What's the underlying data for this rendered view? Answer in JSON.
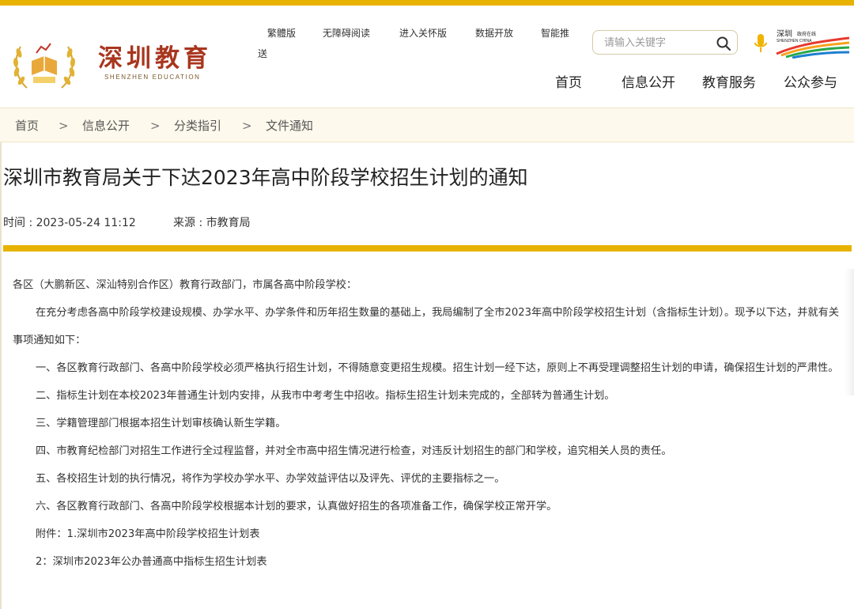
{
  "header": {
    "logo_cn": "深圳教育",
    "logo_en": "SHENZHEN EDUCATION",
    "utility_links": [
      "繁體版",
      "无障碍阅读",
      "进入关怀版",
      "数据开放",
      "智能推",
      "送"
    ],
    "search_placeholder": "请输入关键字",
    "nav": [
      "首页",
      "信息公开",
      "教育服务",
      "公众参与"
    ]
  },
  "breadcrumb": {
    "items": [
      "首页",
      "信息公开",
      "分类指引",
      "文件通知"
    ],
    "separator": ">"
  },
  "article": {
    "title": "深圳市教育局关于下达2023年高中阶段学校招生计划的通知",
    "time": "时间 : 2023-05-24 11:12",
    "source": "来源 : 市教育局",
    "paragraphs": [
      "各区（大鹏新区、深汕特别合作区）教育行政部门，市属各高中阶段学校：",
      "在充分考虑各高中阶段学校建设规模、办学水平、办学条件和历年招生数量的基础上，我局编制了全市2023年高中阶段学校招生计划（含指标生计划）。现予以下达，并就有关事项通知如下：",
      "一、各区教育行政部门、各高中阶段学校必须严格执行招生计划，不得随意变更招生规模。招生计划一经下达，原则上不再受理调整招生计划的申请，确保招生计划的严肃性。",
      "二、指标生计划在本校2023年普通生计划内安排，从我市中考考生中招收。指标生招生计划未完成的，全部转为普通生计划。",
      "三、学籍管理部门根据本招生计划审核确认新生学籍。",
      "四、市教育纪检部门对招生工作进行全过程监督，并对全市高中招生情况进行检查，对违反计划招生的部门和学校，追究相关人员的责任。",
      "五、各校招生计划的执行情况，将作为学校办学水平、办学效益评估以及评先、评优的主要指标之一。",
      "六、各区教育行政部门、各高中阶段学校根据本计划的要求，认真做好招生的各项准备工作，确保学校正常开学。",
      "附件：1.深圳市2023年高中阶段学校招生计划表",
      "2：深圳市2023年公办普通高中指标生招生计划表"
    ]
  },
  "colors": {
    "accent": "#e8b200",
    "logo_red": "#a8361e",
    "breadcrumb_bg": "#fdf9ec"
  }
}
